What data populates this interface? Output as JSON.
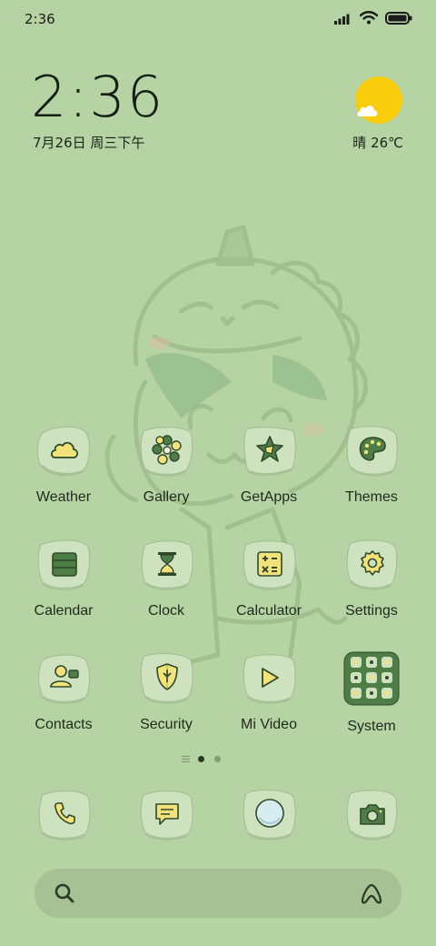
{
  "status_bar": {
    "time": "2:36"
  },
  "clock_widget": {
    "time": "2:36",
    "date": "7月26日 周三下午",
    "weather": "晴 26℃"
  },
  "apps": [
    {
      "label": "Weather",
      "icon": "cloud-icon"
    },
    {
      "label": "Gallery",
      "icon": "flower-icon"
    },
    {
      "label": "GetApps",
      "icon": "getapps-icon"
    },
    {
      "label": "Themes",
      "icon": "palette-icon"
    },
    {
      "label": "Calendar",
      "icon": "calendar-icon"
    },
    {
      "label": "Clock",
      "icon": "hourglass-icon"
    },
    {
      "label": "Calculator",
      "icon": "calculator-icon"
    },
    {
      "label": "Settings",
      "icon": "gear-icon"
    },
    {
      "label": "Contacts",
      "icon": "contact-card-icon"
    },
    {
      "label": "Security",
      "icon": "shield-icon"
    },
    {
      "label": "Mi Video",
      "icon": "play-icon"
    },
    {
      "label": "System",
      "icon": "folder-grid-icon"
    }
  ],
  "dock": [
    {
      "icon": "phone-icon"
    },
    {
      "icon": "message-icon"
    },
    {
      "icon": "browser-icon"
    },
    {
      "icon": "camera-icon"
    }
  ],
  "colors": {
    "background": "#b6d3a4",
    "icon_green": "#4e7d46",
    "icon_yellow": "#f3e27a",
    "sun": "#f9cc0c"
  },
  "page_indicator": {
    "pages": 2,
    "current": 1
  }
}
